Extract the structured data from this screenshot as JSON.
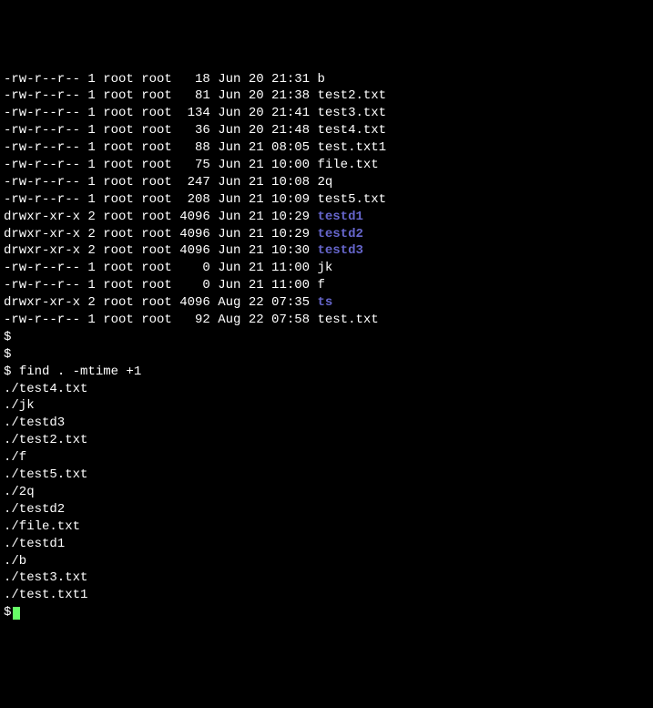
{
  "colors": {
    "bg": "#000000",
    "fg": "#ffffff",
    "dir": "#6666cc",
    "cursor": "#66ff66"
  },
  "listing": [
    {
      "perms": "-rw-r--r--",
      "links": "1",
      "owner": "root",
      "group": "root",
      "size": "18",
      "date": "Jun 20 21:31",
      "name": "b",
      "isdir": false
    },
    {
      "perms": "-rw-r--r--",
      "links": "1",
      "owner": "root",
      "group": "root",
      "size": "81",
      "date": "Jun 20 21:38",
      "name": "test2.txt",
      "isdir": false
    },
    {
      "perms": "-rw-r--r--",
      "links": "1",
      "owner": "root",
      "group": "root",
      "size": "134",
      "date": "Jun 20 21:41",
      "name": "test3.txt",
      "isdir": false
    },
    {
      "perms": "-rw-r--r--",
      "links": "1",
      "owner": "root",
      "group": "root",
      "size": "36",
      "date": "Jun 20 21:48",
      "name": "test4.txt",
      "isdir": false
    },
    {
      "perms": "-rw-r--r--",
      "links": "1",
      "owner": "root",
      "group": "root",
      "size": "88",
      "date": "Jun 21 08:05",
      "name": "test.txt1",
      "isdir": false
    },
    {
      "perms": "-rw-r--r--",
      "links": "1",
      "owner": "root",
      "group": "root",
      "size": "75",
      "date": "Jun 21 10:00",
      "name": "file.txt",
      "isdir": false
    },
    {
      "perms": "-rw-r--r--",
      "links": "1",
      "owner": "root",
      "group": "root",
      "size": "247",
      "date": "Jun 21 10:08",
      "name": "2q",
      "isdir": false
    },
    {
      "perms": "-rw-r--r--",
      "links": "1",
      "owner": "root",
      "group": "root",
      "size": "208",
      "date": "Jun 21 10:09",
      "name": "test5.txt",
      "isdir": false
    },
    {
      "perms": "drwxr-xr-x",
      "links": "2",
      "owner": "root",
      "group": "root",
      "size": "4096",
      "date": "Jun 21 10:29",
      "name": "testd1",
      "isdir": true
    },
    {
      "perms": "drwxr-xr-x",
      "links": "2",
      "owner": "root",
      "group": "root",
      "size": "4096",
      "date": "Jun 21 10:29",
      "name": "testd2",
      "isdir": true
    },
    {
      "perms": "drwxr-xr-x",
      "links": "2",
      "owner": "root",
      "group": "root",
      "size": "4096",
      "date": "Jun 21 10:30",
      "name": "testd3",
      "isdir": true
    },
    {
      "perms": "-rw-r--r--",
      "links": "1",
      "owner": "root",
      "group": "root",
      "size": "0",
      "date": "Jun 21 11:00",
      "name": "jk",
      "isdir": false
    },
    {
      "perms": "-rw-r--r--",
      "links": "1",
      "owner": "root",
      "group": "root",
      "size": "0",
      "date": "Jun 21 11:00",
      "name": "f",
      "isdir": false
    },
    {
      "perms": "drwxr-xr-x",
      "links": "2",
      "owner": "root",
      "group": "root",
      "size": "4096",
      "date": "Aug 22 07:35",
      "name": "ts",
      "isdir": true
    },
    {
      "perms": "-rw-r--r--",
      "links": "1",
      "owner": "root",
      "group": "root",
      "size": "92",
      "date": "Aug 22 07:58",
      "name": "test.txt",
      "isdir": false
    }
  ],
  "prompt": "$",
  "empty_prompts": 2,
  "command": "find . -mtime +1",
  "output": [
    "./test4.txt",
    "./jk",
    "./testd3",
    "./test2.txt",
    "./f",
    "./test5.txt",
    "./2q",
    "./testd2",
    "./file.txt",
    "./testd1",
    "./b",
    "./test3.txt",
    "./test.txt1"
  ]
}
